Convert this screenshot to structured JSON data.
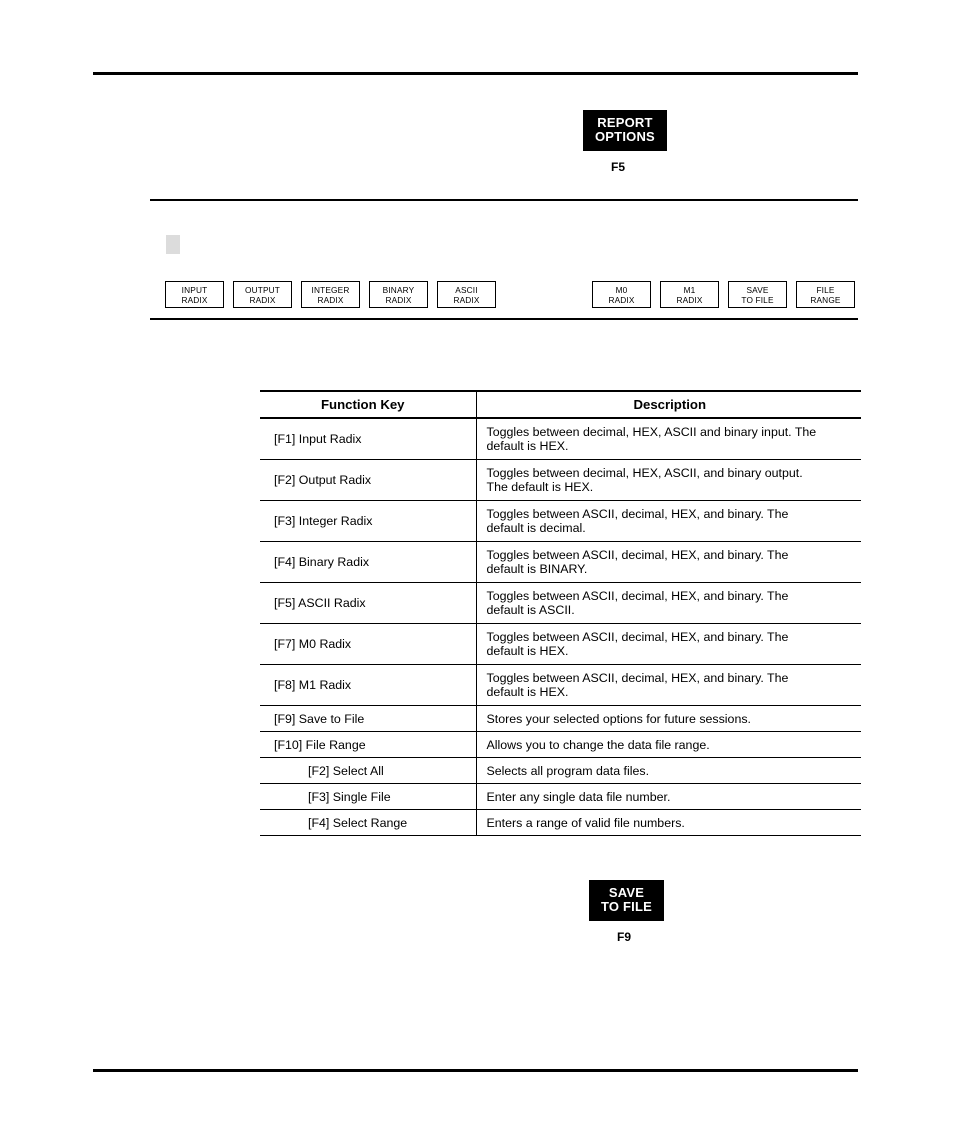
{
  "page": {
    "gray_marker": "#dcdcdc"
  },
  "callouts": [
    {
      "id": "report-options",
      "line1": "REPORT",
      "line2": "OPTIONS",
      "key_label": "F5"
    },
    {
      "id": "save-to-file",
      "line1": "SAVE",
      "line2": "TO FILE",
      "key_label": "F9"
    }
  ],
  "softkeys": {
    "left": [
      {
        "line1": "INPUT",
        "line2": "RADIX"
      },
      {
        "line1": "OUTPUT",
        "line2": "RADIX"
      },
      {
        "line1": "INTEGER",
        "line2": "RADIX"
      },
      {
        "line1": "BINARY",
        "line2": "RADIX"
      },
      {
        "line1": "ASCII",
        "line2": "RADIX"
      }
    ],
    "right": [
      {
        "line1": "M0",
        "line2": "RADIX"
      },
      {
        "line1": "M1",
        "line2": "RADIX"
      },
      {
        "line1": "SAVE",
        "line2": "TO FILE"
      },
      {
        "line1": "FILE",
        "line2": "RANGE"
      }
    ]
  },
  "table": {
    "headers": {
      "key": "Function Key",
      "description": "Description"
    },
    "rows": [
      {
        "key": "[F1] Input Radix",
        "desc_line1": "Toggles between decimal, HEX, ASCII and binary input.  The",
        "desc_line2": "default is HEX.",
        "indent": false,
        "tall": true
      },
      {
        "key": "[F2] Output Radix",
        "desc_line1": "Toggles between decimal, HEX, ASCII, and binary output.",
        "desc_line2": "The default is HEX.",
        "indent": false,
        "tall": true
      },
      {
        "key": "[F3] Integer Radix",
        "desc_line1": "Toggles between ASCII, decimal, HEX, and binary.  The",
        "desc_line2": "default is decimal.",
        "indent": false,
        "tall": true
      },
      {
        "key": "[F4] Binary Radix",
        "desc_line1": "Toggles between ASCII, decimal, HEX, and binary.  The",
        "desc_line2": "default is BINARY.",
        "indent": false,
        "tall": true
      },
      {
        "key": "[F5] ASCII Radix",
        "desc_line1": "Toggles between ASCII, decimal, HEX, and binary.  The",
        "desc_line2": "default is ASCII.",
        "indent": false,
        "tall": true
      },
      {
        "key": "[F7] M0 Radix",
        "desc_line1": "Toggles between ASCII, decimal, HEX, and binary.  The",
        "desc_line2": "default is HEX.",
        "indent": false,
        "tall": true
      },
      {
        "key": "[F8] M1 Radix",
        "desc_line1": "Toggles between ASCII, decimal, HEX, and binary.  The",
        "desc_line2": "default is HEX.",
        "indent": false,
        "tall": true
      },
      {
        "key": "[F9] Save to File",
        "desc_line1": "Stores your selected options for future sessions.",
        "desc_line2": "",
        "indent": false,
        "tall": false
      },
      {
        "key": "[F10] File Range",
        "desc_line1": "Allows you to change the data file range.",
        "desc_line2": "",
        "indent": false,
        "tall": false
      },
      {
        "key": "[F2] Select All",
        "desc_line1": "Selects all program data files.",
        "desc_line2": "",
        "indent": true,
        "tall": false
      },
      {
        "key": "[F3] Single File",
        "desc_line1": "Enter any single data file number.",
        "desc_line2": "",
        "indent": true,
        "tall": false
      },
      {
        "key": "[F4] Select Range",
        "desc_line1": "Enters a range of valid file numbers.",
        "desc_line2": "",
        "indent": true,
        "tall": false
      }
    ]
  }
}
